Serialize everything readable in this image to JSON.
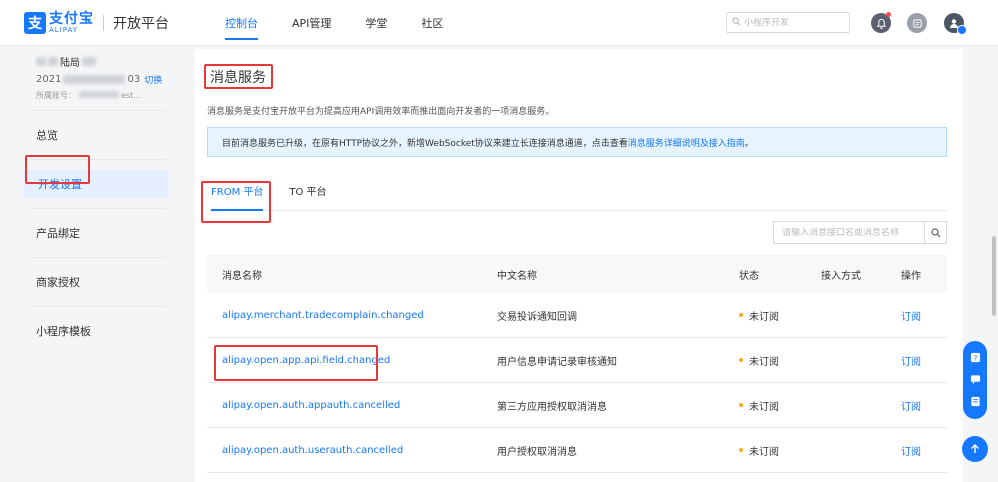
{
  "header": {
    "logo_cn": "支付宝",
    "logo_en": "ALIPAY",
    "logo_mark": "支",
    "platform_title": "开放平台",
    "nav": [
      {
        "label": "控制台",
        "active": true
      },
      {
        "label": "API管理",
        "active": false
      },
      {
        "label": "学堂",
        "active": false
      },
      {
        "label": "社区",
        "active": false
      }
    ],
    "search_placeholder": "小程序开发",
    "icons": [
      "notification-bell-icon",
      "message-icon",
      "user-avatar-icon"
    ]
  },
  "sidebar": {
    "account": {
      "name_suffix": "陆局",
      "id_prefix": "2021",
      "id_suffix": "03",
      "switch_label": "切换",
      "belong_label": "所属账号：",
      "belong_suffix": "est..."
    },
    "items": [
      {
        "label": "总览",
        "active": false
      },
      {
        "label": "开发设置",
        "active": true
      },
      {
        "label": "产品绑定",
        "active": false
      },
      {
        "label": "商家授权",
        "active": false
      },
      {
        "label": "小程序模板",
        "active": false
      }
    ]
  },
  "main": {
    "title": "消息服务",
    "description": "消息服务是支付宝开放平台为提高应用API调用效率而推出面向开发者的一项消息服务。",
    "notice_text": "目前消息服务已升级，在原有HTTP协议之外，新增WebSocket协议来建立长连接消息通道，点击查看",
    "notice_link": "消息服务详细说明及接入指南",
    "notice_end": "。",
    "tabs": [
      {
        "label": "FROM 平台",
        "active": true
      },
      {
        "label": "TO 平台",
        "active": false
      }
    ],
    "table_search_placeholder": "请输入消息接口名或消息名称",
    "columns": [
      "消息名称",
      "中文名称",
      "状态",
      "接入方式",
      "操作"
    ],
    "rows": [
      {
        "name": "alipay.merchant.tradecomplain.changed",
        "cn_name": "交易投诉通知回调",
        "status": "未订阅",
        "access": "",
        "action": "订阅"
      },
      {
        "name": "alipay.open.app.api.field.changed",
        "cn_name": "用户信息申请记录审核通知",
        "status": "未订阅",
        "access": "",
        "action": "订阅"
      },
      {
        "name": "alipay.open.auth.appauth.cancelled",
        "cn_name": "第三方应用授权取消消息",
        "status": "未订阅",
        "access": "",
        "action": "订阅"
      },
      {
        "name": "alipay.open.auth.userauth.cancelled",
        "cn_name": "用户授权取消消息",
        "status": "未订阅",
        "access": "",
        "action": "订阅"
      }
    ]
  },
  "floating": {
    "icons": [
      "help-icon",
      "chat-icon",
      "feedback-icon",
      "back-to-top-icon"
    ]
  },
  "colors": {
    "accent": "#1677ff",
    "highlight_box": "#e5383b",
    "status_dot": "#faad14",
    "notice_bg": "#e6f4ff"
  }
}
